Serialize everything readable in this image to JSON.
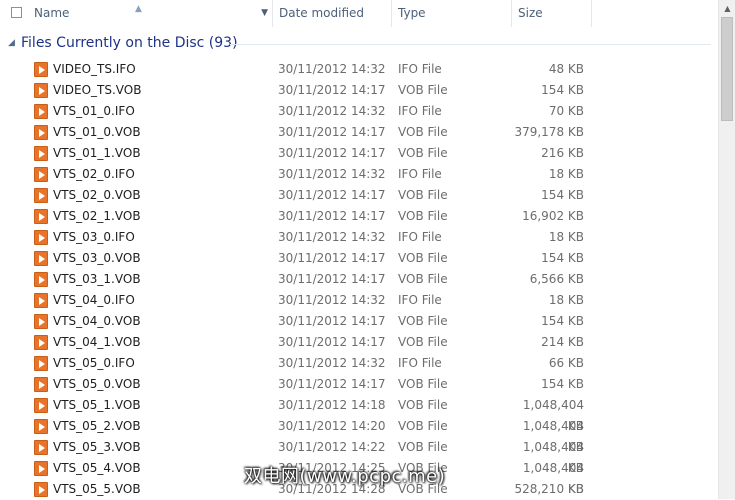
{
  "columns": {
    "name": "Name",
    "date": "Date modified",
    "type": "Type",
    "size": "Size"
  },
  "group": {
    "title": "Files Currently on the Disc (93)"
  },
  "icons": {
    "file": "vob-file-icon",
    "collapse": "chevron-down-icon",
    "sort": "sort-up-icon"
  },
  "colors": {
    "file_icon": "#e8732a",
    "group_title": "#1e3287",
    "header_text": "#4c607a"
  },
  "files": [
    {
      "name": "VIDEO_TS.IFO",
      "date": "30/11/2012 14:32",
      "type": "IFO File",
      "size": "48 KB"
    },
    {
      "name": "VIDEO_TS.VOB",
      "date": "30/11/2012 14:17",
      "type": "VOB File",
      "size": "154 KB"
    },
    {
      "name": "VTS_01_0.IFO",
      "date": "30/11/2012 14:32",
      "type": "IFO File",
      "size": "70 KB"
    },
    {
      "name": "VTS_01_0.VOB",
      "date": "30/11/2012 14:17",
      "type": "VOB File",
      "size": "379,178 KB"
    },
    {
      "name": "VTS_01_1.VOB",
      "date": "30/11/2012 14:17",
      "type": "VOB File",
      "size": "216 KB"
    },
    {
      "name": "VTS_02_0.IFO",
      "date": "30/11/2012 14:32",
      "type": "IFO File",
      "size": "18 KB"
    },
    {
      "name": "VTS_02_0.VOB",
      "date": "30/11/2012 14:17",
      "type": "VOB File",
      "size": "154 KB"
    },
    {
      "name": "VTS_02_1.VOB",
      "date": "30/11/2012 14:17",
      "type": "VOB File",
      "size": "16,902 KB"
    },
    {
      "name": "VTS_03_0.IFO",
      "date": "30/11/2012 14:32",
      "type": "IFO File",
      "size": "18 KB"
    },
    {
      "name": "VTS_03_0.VOB",
      "date": "30/11/2012 14:17",
      "type": "VOB File",
      "size": "154 KB"
    },
    {
      "name": "VTS_03_1.VOB",
      "date": "30/11/2012 14:17",
      "type": "VOB File",
      "size": "6,566 KB"
    },
    {
      "name": "VTS_04_0.IFO",
      "date": "30/11/2012 14:32",
      "type": "IFO File",
      "size": "18 KB"
    },
    {
      "name": "VTS_04_0.VOB",
      "date": "30/11/2012 14:17",
      "type": "VOB File",
      "size": "154 KB"
    },
    {
      "name": "VTS_04_1.VOB",
      "date": "30/11/2012 14:17",
      "type": "VOB File",
      "size": "214 KB"
    },
    {
      "name": "VTS_05_0.IFO",
      "date": "30/11/2012 14:32",
      "type": "IFO File",
      "size": "66 KB"
    },
    {
      "name": "VTS_05_0.VOB",
      "date": "30/11/2012 14:17",
      "type": "VOB File",
      "size": "154 KB"
    },
    {
      "name": "VTS_05_1.VOB",
      "date": "30/11/2012 14:18",
      "type": "VOB File",
      "size": "1,048,404 KB"
    },
    {
      "name": "VTS_05_2.VOB",
      "date": "30/11/2012 14:20",
      "type": "VOB File",
      "size": "1,048,404 KB"
    },
    {
      "name": "VTS_05_3.VOB",
      "date": "30/11/2012 14:22",
      "type": "VOB File",
      "size": "1,048,404 KB"
    },
    {
      "name": "VTS_05_4.VOB",
      "date": "30/11/2012 14:25",
      "type": "VOB File",
      "size": "1,048,404 KB"
    },
    {
      "name": "VTS_05_5.VOB",
      "date": "30/11/2012 14:28",
      "type": "VOB File",
      "size": "528,210 KB"
    }
  ],
  "watermark": "双电网(www.pcpc.me)"
}
